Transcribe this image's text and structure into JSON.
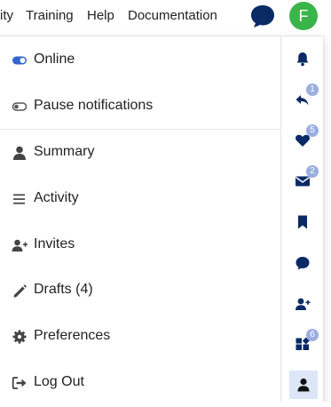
{
  "header": {
    "nav": [
      "ity",
      "Training",
      "Help",
      "Documentation"
    ],
    "avatar_letter": "F"
  },
  "colors": {
    "accent": "#0a2a66",
    "online_toggle": "#3366cc",
    "badge": "#9aaee0",
    "avatar": "#3ab54a",
    "active_bg": "#dce6f7"
  },
  "menu": {
    "status": [
      {
        "label": "Online",
        "icon": "toggle-on-icon"
      },
      {
        "label": "Pause notifications",
        "icon": "toggle-off-icon"
      }
    ],
    "items": [
      {
        "label": "Summary",
        "icon": "user-icon"
      },
      {
        "label": "Activity",
        "icon": "list-icon"
      },
      {
        "label": "Invites",
        "icon": "user-plus-icon"
      },
      {
        "label": "Drafts (4)",
        "icon": "pencil-icon"
      },
      {
        "label": "Preferences",
        "icon": "gear-icon"
      },
      {
        "label": "Log Out",
        "icon": "logout-icon"
      }
    ]
  },
  "quick_access": [
    {
      "icon": "bell-icon",
      "badge": ""
    },
    {
      "icon": "reply-icon",
      "badge": "1"
    },
    {
      "icon": "heart-icon",
      "badge": "5"
    },
    {
      "icon": "envelope-icon",
      "badge": "2"
    },
    {
      "icon": "bookmark-icon",
      "badge": ""
    },
    {
      "icon": "chat-bubble-icon",
      "badge": ""
    },
    {
      "icon": "user-plus-icon",
      "badge": ""
    },
    {
      "icon": "grid-icon",
      "badge": "6"
    },
    {
      "icon": "user-icon",
      "badge": ""
    }
  ]
}
